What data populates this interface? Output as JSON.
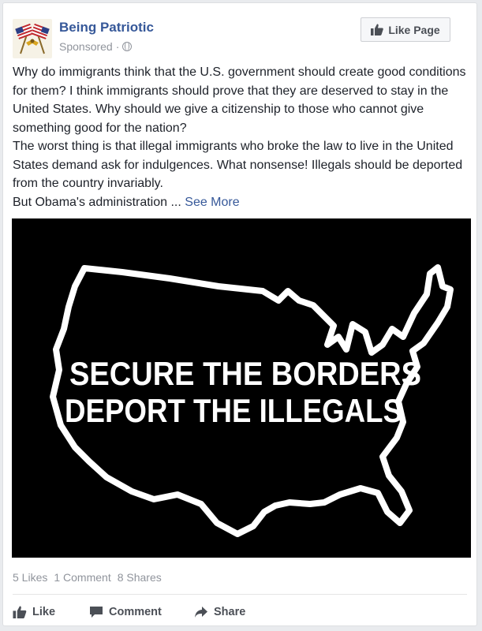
{
  "post": {
    "page_name": "Being Patriotic",
    "sponsored_label": "Sponsored",
    "separator": "·",
    "like_page_label": "Like Page",
    "body_paragraphs": [
      "Why do immigrants think that the U.S. government should create good conditions for them? I think immigrants should prove that they are deserved to stay in the United States. Why should we give a citizenship to those who cannot give something good for the nation?",
      "The worst thing is that illegal immigrants who broke the law to live in the United States demand ask for indulgences. What nonsense! Illegals should be deported from the country invariably."
    ],
    "truncated_line": "But Obama's administration ...",
    "see_more_label": "See More",
    "image": {
      "line1": "SECURE THE BORDERS",
      "line2": "DEPORT THE ILLEGALS",
      "background": "#000000",
      "foreground": "#ffffff"
    }
  },
  "stats": {
    "likes": "5 Likes",
    "comments": "1 Comment",
    "shares": "8 Shares"
  },
  "actions": {
    "like": "Like",
    "comment": "Comment",
    "share": "Share"
  },
  "colors": {
    "link_blue": "#365899",
    "meta_gray": "#90949c",
    "text": "#1d2129"
  },
  "icons": [
    "globe-icon",
    "thumbs-up-icon",
    "comment-icon",
    "share-icon",
    "flags-logo-icon"
  ]
}
